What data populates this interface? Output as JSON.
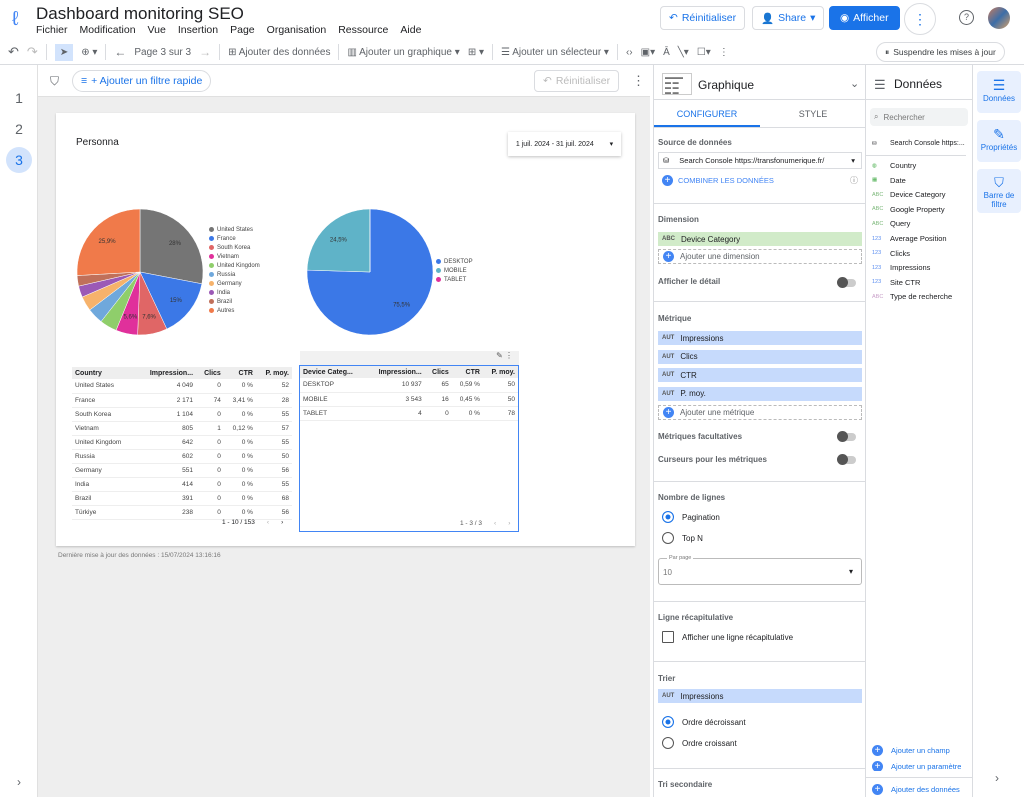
{
  "app": {
    "title": "Dashboard monitoring SEO",
    "menu": [
      "Fichier",
      "Modification",
      "Vue",
      "Insertion",
      "Page",
      "Organisation",
      "Ressource",
      "Aide"
    ],
    "reset": "Réinitialiser",
    "share": "Share",
    "view": "Afficher"
  },
  "toolbar": {
    "page": "Page 3 sur 3",
    "add_data": "Ajouter des données",
    "add_chart": "Ajouter un graphique",
    "add_selector": "Ajouter un sélecteur",
    "suspend": "Suspendre les mises à jour"
  },
  "pages": [
    "1",
    "2",
    "3"
  ],
  "filterbar": {
    "add_filter": "+ Ajouter un filtre rapide",
    "reset": "Réinitialiser"
  },
  "report": {
    "title": "Personna",
    "date_range": "1 juil. 2024 - 31 juil. 2024",
    "updated": "Dernière mise à jour des données : 15/07/2024 13:16:16"
  },
  "chart_data": [
    {
      "type": "pie",
      "series": [
        {
          "label": "United States",
          "value": 28,
          "color": "#757575",
          "shown": "28%"
        },
        {
          "label": "France",
          "value": 15,
          "color": "#3b78e7",
          "shown": "15%"
        },
        {
          "label": "South Korea",
          "value": 7.6,
          "color": "#e06666",
          "shown": "7,6%"
        },
        {
          "label": "Vietnam",
          "value": 5.6,
          "color": "#e0309b",
          "shown": "5,6%"
        },
        {
          "label": "United Kingdom",
          "value": 4.4,
          "color": "#8fce6b"
        },
        {
          "label": "Russia",
          "value": 4.1,
          "color": "#6fa8dc"
        },
        {
          "label": "Germany",
          "value": 3.8,
          "color": "#f6b26b"
        },
        {
          "label": "India",
          "value": 2.9,
          "color": "#9b59b6"
        },
        {
          "label": "Brazil",
          "value": 2.7,
          "color": "#c0705a"
        },
        {
          "label": "Autres",
          "value": 25.9,
          "color": "#f07a4a",
          "shown": "25,9%"
        }
      ],
      "legend": "right"
    },
    {
      "type": "pie",
      "series": [
        {
          "label": "DESKTOP",
          "value": 75.5,
          "color": "#3b78e7",
          "shown": "75,5%"
        },
        {
          "label": "MOBILE",
          "value": 24.5,
          "color": "#5fb3c8",
          "shown": "24,5%"
        },
        {
          "label": "TABLET",
          "value": 0.03,
          "color": "#e0309b"
        }
      ],
      "legend": "right"
    }
  ],
  "table1": {
    "headers": [
      "Country",
      "Impression...",
      "Clics",
      "CTR",
      "P. moy."
    ],
    "rows": [
      [
        "United States",
        "4 049",
        "0",
        "0 %",
        "52"
      ],
      [
        "France",
        "2 171",
        "74",
        "3,41 %",
        "28"
      ],
      [
        "South Korea",
        "1 104",
        "0",
        "0 %",
        "55"
      ],
      [
        "Vietnam",
        "805",
        "1",
        "0,12 %",
        "57"
      ],
      [
        "United Kingdom",
        "642",
        "0",
        "0 %",
        "55"
      ],
      [
        "Russia",
        "602",
        "0",
        "0 %",
        "50"
      ],
      [
        "Germany",
        "551",
        "0",
        "0 %",
        "56"
      ],
      [
        "India",
        "414",
        "0",
        "0 %",
        "55"
      ],
      [
        "Brazil",
        "391",
        "0",
        "0 %",
        "68"
      ],
      [
        "Türkiye",
        "238",
        "0",
        "0 %",
        "56"
      ]
    ],
    "pager": "1 - 10 / 153"
  },
  "table2": {
    "headers": [
      "Device Categ...",
      "Impression...",
      "Clics",
      "CTR",
      "P. moy."
    ],
    "rows": [
      [
        "DESKTOP",
        "10 937",
        "65",
        "0,59 %",
        "50"
      ],
      [
        "MOBILE",
        "3 543",
        "16",
        "0,45 %",
        "50"
      ],
      [
        "TABLET",
        "4",
        "0",
        "0 %",
        "78"
      ]
    ],
    "pager": "1 - 3 / 3"
  },
  "panel": {
    "title": "Graphique",
    "tabs": [
      "CONFIGURER",
      "STYLE"
    ],
    "source_label": "Source de données",
    "source": "Search Console https://transfonumerique.fr/",
    "combine": "COMBINER LES DONNÉES",
    "dimension_label": "Dimension",
    "dimension": "Device Category",
    "add_dimension": "Ajouter une dimension",
    "show_detail": "Afficher le détail",
    "metric_label": "Métrique",
    "metrics": [
      "Impressions",
      "Clics",
      "CTR",
      "P. moy."
    ],
    "metric_tag": "AUT",
    "add_metric": "Ajouter une métrique",
    "optional_metrics": "Métriques facultatives",
    "metric_sliders": "Curseurs pour les métriques",
    "rows_label": "Nombre de lignes",
    "pagination": "Pagination",
    "topn": "Top N",
    "per_page_label": "Par page",
    "per_page": "10",
    "summary_label": "Ligne récapitulative",
    "summary": "Afficher une ligne récapitulative",
    "sort_label": "Trier",
    "sort": "Impressions",
    "desc": "Ordre décroissant",
    "asc": "Ordre croissant",
    "secondary": "Tri secondaire"
  },
  "data_panel": {
    "title": "Données",
    "search": "Rechercher",
    "source": "Search Console https:...",
    "fields": [
      {
        "t": "geo",
        "n": "Country"
      },
      {
        "t": "date",
        "n": "Date"
      },
      {
        "t": "ABC",
        "n": "Device Category"
      },
      {
        "t": "ABC",
        "n": "Google Property"
      },
      {
        "t": "ABC",
        "n": "Query"
      },
      {
        "t": "123",
        "n": "Average Position"
      },
      {
        "t": "123",
        "n": "Clicks"
      },
      {
        "t": "123",
        "n": "Impressions"
      },
      {
        "t": "123",
        "n": "Site CTR"
      },
      {
        "t": "ABC",
        "n": "Type de recherche"
      }
    ],
    "add_field": "Ajouter un champ",
    "add_param": "Ajouter un paramètre",
    "add_data": "Ajouter des données"
  },
  "rail": [
    "Données",
    "Propriétés",
    "Barre de filtre"
  ],
  "colors": {
    "accent": "#1a73e8",
    "dimension_chip": "#d1ebc9",
    "metric_chip": "#c6dafc"
  }
}
